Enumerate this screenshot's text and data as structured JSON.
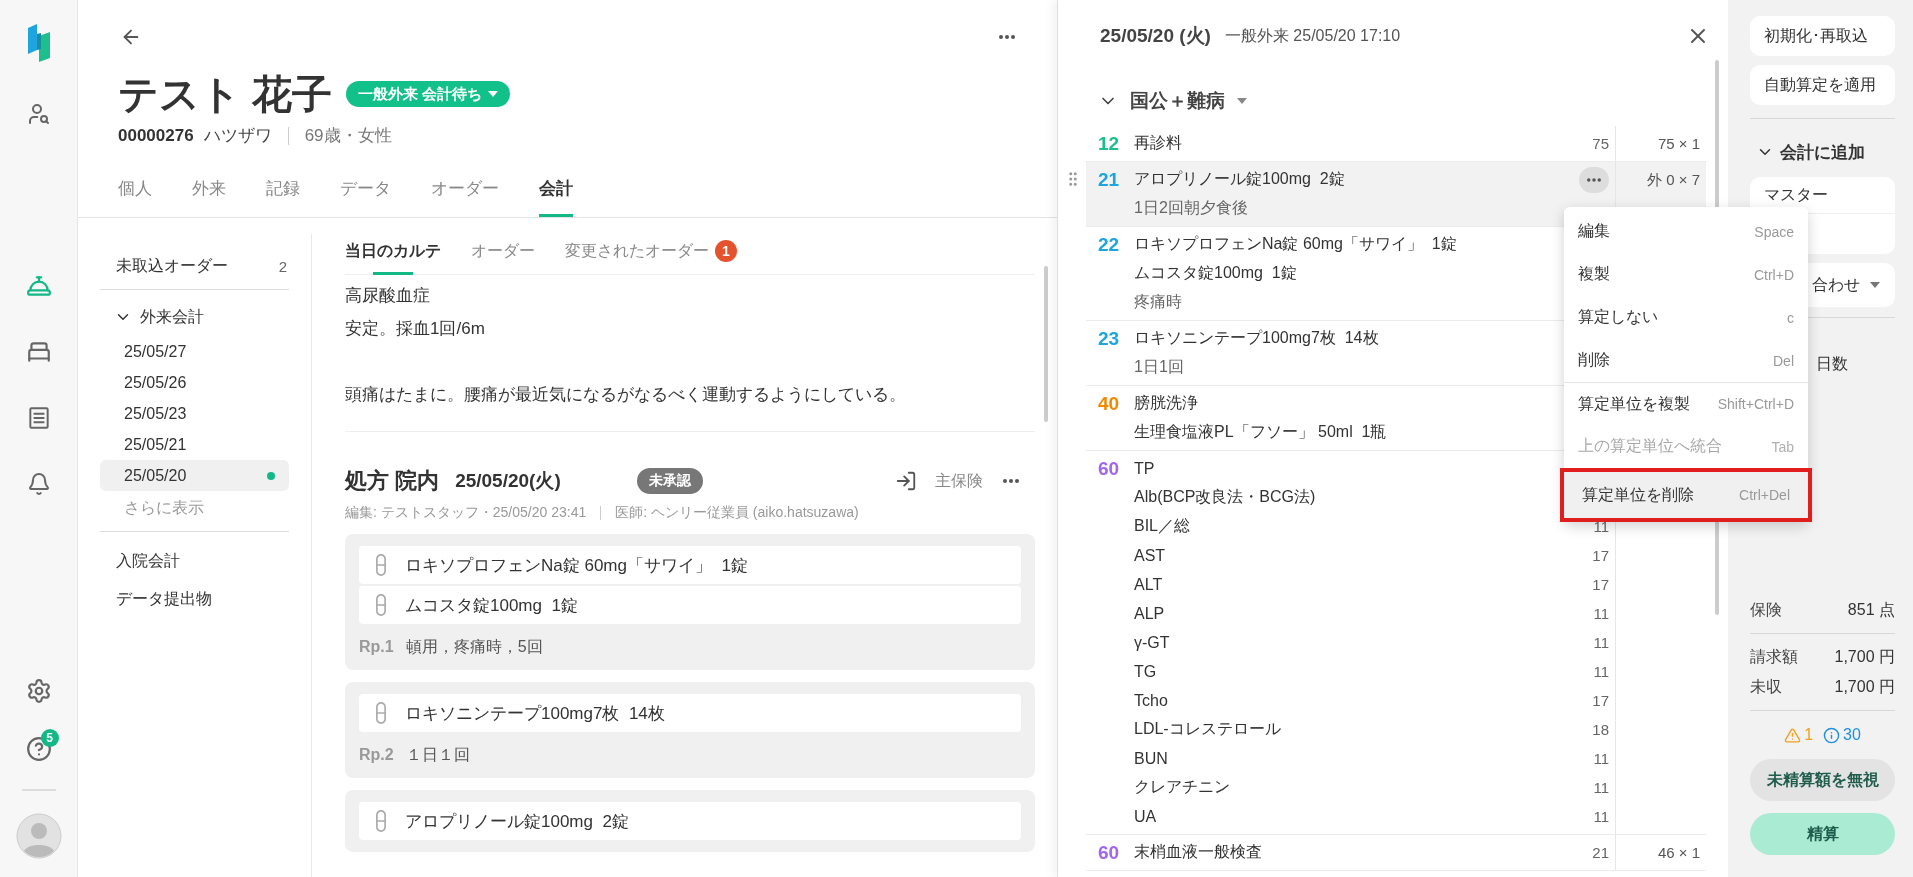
{
  "rail": {
    "top": [
      {
        "kind": "person-search",
        "selected": false
      }
    ],
    "middle": [
      {
        "kind": "reception",
        "selected": true
      },
      {
        "kind": "bed",
        "selected": false
      },
      {
        "kind": "list",
        "selected": false
      },
      {
        "kind": "bell",
        "selected": false
      }
    ],
    "bottom": [
      {
        "kind": "settings",
        "selected": false
      },
      {
        "kind": "help",
        "selected": false,
        "badge": "5"
      }
    ]
  },
  "patient": {
    "name": "テスト 花子",
    "status": "一般外来 会計待ち",
    "id": "00000276",
    "kana": "ハツザワ",
    "info": "69歳・女性"
  },
  "tabs": [
    {
      "label": "個人",
      "selected": false
    },
    {
      "label": "外来",
      "selected": false
    },
    {
      "label": "記録",
      "selected": false
    },
    {
      "label": "データ",
      "selected": false
    },
    {
      "label": "オーダー",
      "selected": false
    },
    {
      "label": "会計",
      "selected": true
    }
  ],
  "nav": {
    "pending": {
      "label": "未取込オーダー",
      "count": "2"
    },
    "group": {
      "label": "外来会計",
      "expanded": true,
      "items": [
        {
          "label": "25/05/27",
          "selected": false,
          "dot": false
        },
        {
          "label": "25/05/26",
          "selected": false,
          "dot": false
        },
        {
          "label": "25/05/23",
          "selected": false,
          "dot": false
        },
        {
          "label": "25/05/21",
          "selected": false,
          "dot": false
        },
        {
          "label": "25/05/20",
          "selected": true,
          "dot": true
        }
      ]
    },
    "more": "さらに表示",
    "links": [
      "入院会計",
      "データ提出物"
    ]
  },
  "subtabs": [
    {
      "label": "当日のカルテ",
      "selected": true
    },
    {
      "label": "オーダー",
      "selected": false
    },
    {
      "label": "変更されたオーダー",
      "selected": false,
      "badge": "1"
    }
  ],
  "karte": [
    [
      "高尿酸血症",
      "安定。採血1回/6m"
    ],
    [
      "頭痛はたまに。腰痛が最近気になるがなるべく運動するようにしている。"
    ]
  ],
  "prescription": {
    "title": "処方 院内",
    "date": "25/05/20(火)",
    "status": "未承認",
    "insurance": "主保険",
    "editor": "編集: テストスタッフ・25/05/20 23:41",
    "doctor": "医師: ヘンリー従業員 (aiko.hatsuzawa)",
    "rps": [
      {
        "drugs": [
          "ロキソプロフェンNa錠 60mg「サワイ」  1錠",
          "ムコスタ錠100mg  1錠"
        ],
        "label": "Rp.1",
        "usage": "頓用，疼痛時，5回"
      },
      {
        "drugs": [
          "ロキソニンテープ100mg7枚  14枚"
        ],
        "label": "Rp.2",
        "usage": "１日１回"
      },
      {
        "drugs": [
          "アロプリノール錠100mg  2錠"
        ]
      }
    ]
  },
  "drawer": {
    "date": "25/05/20 (火)",
    "visit": "一般外来 25/05/20 17:10",
    "group": {
      "label": "国公＋難病",
      "expanded": true
    },
    "rows": [
      {
        "code": "12",
        "color": "#1dbf8e",
        "selected": false,
        "amount": "75 × 1",
        "lines": [
          {
            "text": "再診料",
            "points": "75",
            "kind": "item"
          }
        ]
      },
      {
        "code": "21",
        "color": "#1ea5e0",
        "selected": true,
        "amount": "外 0 × 7",
        "lines": [
          {
            "text": "アロプリノール錠100mg  2錠",
            "kind": "item"
          },
          {
            "text": "1日2回朝夕食後",
            "kind": "note"
          }
        ]
      },
      {
        "code": "22",
        "color": "#1ea5e0",
        "selected": false,
        "lines": [
          {
            "text": "ロキソプロフェンNa錠 60mg「サワイ」  1錠",
            "kind": "item"
          },
          {
            "text": "ムコスタ錠100mg  1錠",
            "kind": "item"
          },
          {
            "text": "疼痛時",
            "kind": "note"
          }
        ]
      },
      {
        "code": "23",
        "color": "#1ea5e0",
        "selected": false,
        "lines": [
          {
            "text": "ロキソニンテープ100mg7枚  14枚",
            "kind": "item"
          },
          {
            "text": "1日1回",
            "kind": "note"
          }
        ]
      },
      {
        "code": "40",
        "color": "#f08a00",
        "selected": false,
        "lines": [
          {
            "text": "膀胱洗浄",
            "kind": "item"
          },
          {
            "text": "生理食塩液PL「フソー」 50ml  1瓶",
            "kind": "item"
          }
        ]
      },
      {
        "code": "60",
        "color": "#a066f0",
        "selected": false,
        "lines": [
          {
            "text": "TP",
            "kind": "item"
          },
          {
            "text": "Alb(BCP改良法・BCG法)",
            "kind": "item"
          },
          {
            "text": "BIL／総",
            "points": "11",
            "kind": "item"
          },
          {
            "text": "AST",
            "points": "17",
            "kind": "item"
          },
          {
            "text": "ALT",
            "points": "17",
            "kind": "item"
          },
          {
            "text": "ALP",
            "points": "11",
            "kind": "item"
          },
          {
            "text": "γ-GT",
            "points": "11",
            "kind": "item"
          },
          {
            "text": "TG",
            "points": "11",
            "kind": "item"
          },
          {
            "text": "Tcho",
            "points": "17",
            "kind": "item"
          },
          {
            "text": "LDL-コレステロール",
            "points": "18",
            "kind": "item"
          },
          {
            "text": "BUN",
            "points": "11",
            "kind": "item"
          },
          {
            "text": "クレアチニン",
            "points": "11",
            "kind": "item"
          },
          {
            "text": "UA",
            "points": "11",
            "kind": "item"
          }
        ]
      },
      {
        "code": "60",
        "color": "#a066f0",
        "selected": false,
        "amount": "46 × 1",
        "lines": [
          {
            "text": "末梢血液一般検査",
            "points": "21",
            "kind": "item"
          }
        ]
      }
    ]
  },
  "menu": [
    {
      "label": "編集",
      "shortcut": "Space",
      "disabled": false,
      "highlighted": false,
      "divider_before": false
    },
    {
      "label": "複製",
      "shortcut": "Ctrl+D",
      "disabled": false,
      "highlighted": false,
      "divider_before": false
    },
    {
      "label": "算定しない",
      "shortcut": "c",
      "disabled": false,
      "highlighted": false,
      "divider_before": false
    },
    {
      "label": "削除",
      "shortcut": "Del",
      "disabled": false,
      "highlighted": false,
      "divider_before": false
    },
    {
      "label": "算定単位を複製",
      "shortcut": "Shift+Ctrl+D",
      "disabled": false,
      "highlighted": false,
      "divider_before": true
    },
    {
      "label": "上の算定単位へ統合",
      "shortcut": "Tab",
      "disabled": true,
      "highlighted": false,
      "divider_before": false
    },
    {
      "label": "算定単位を削除",
      "shortcut": "Ctrl+Del",
      "disabled": false,
      "highlighted": true,
      "divider_before": false
    }
  ],
  "side": {
    "buttons": [
      "初期化･再取込",
      "自動算定を適用"
    ],
    "add": {
      "label": "会計に追加",
      "expanded": true,
      "master": "マスター",
      "combo": "合わせ",
      "days": "日数"
    },
    "insurance": {
      "label": "保険",
      "value": "851 点"
    },
    "totals": [
      {
        "label": "請求額",
        "value": "1,700 円"
      },
      {
        "label": "未収",
        "value": "1,700 円"
      }
    ],
    "warnings": "1",
    "infos": "30",
    "ignore_button": "未精算額を無視",
    "settle_button": "精算"
  }
}
